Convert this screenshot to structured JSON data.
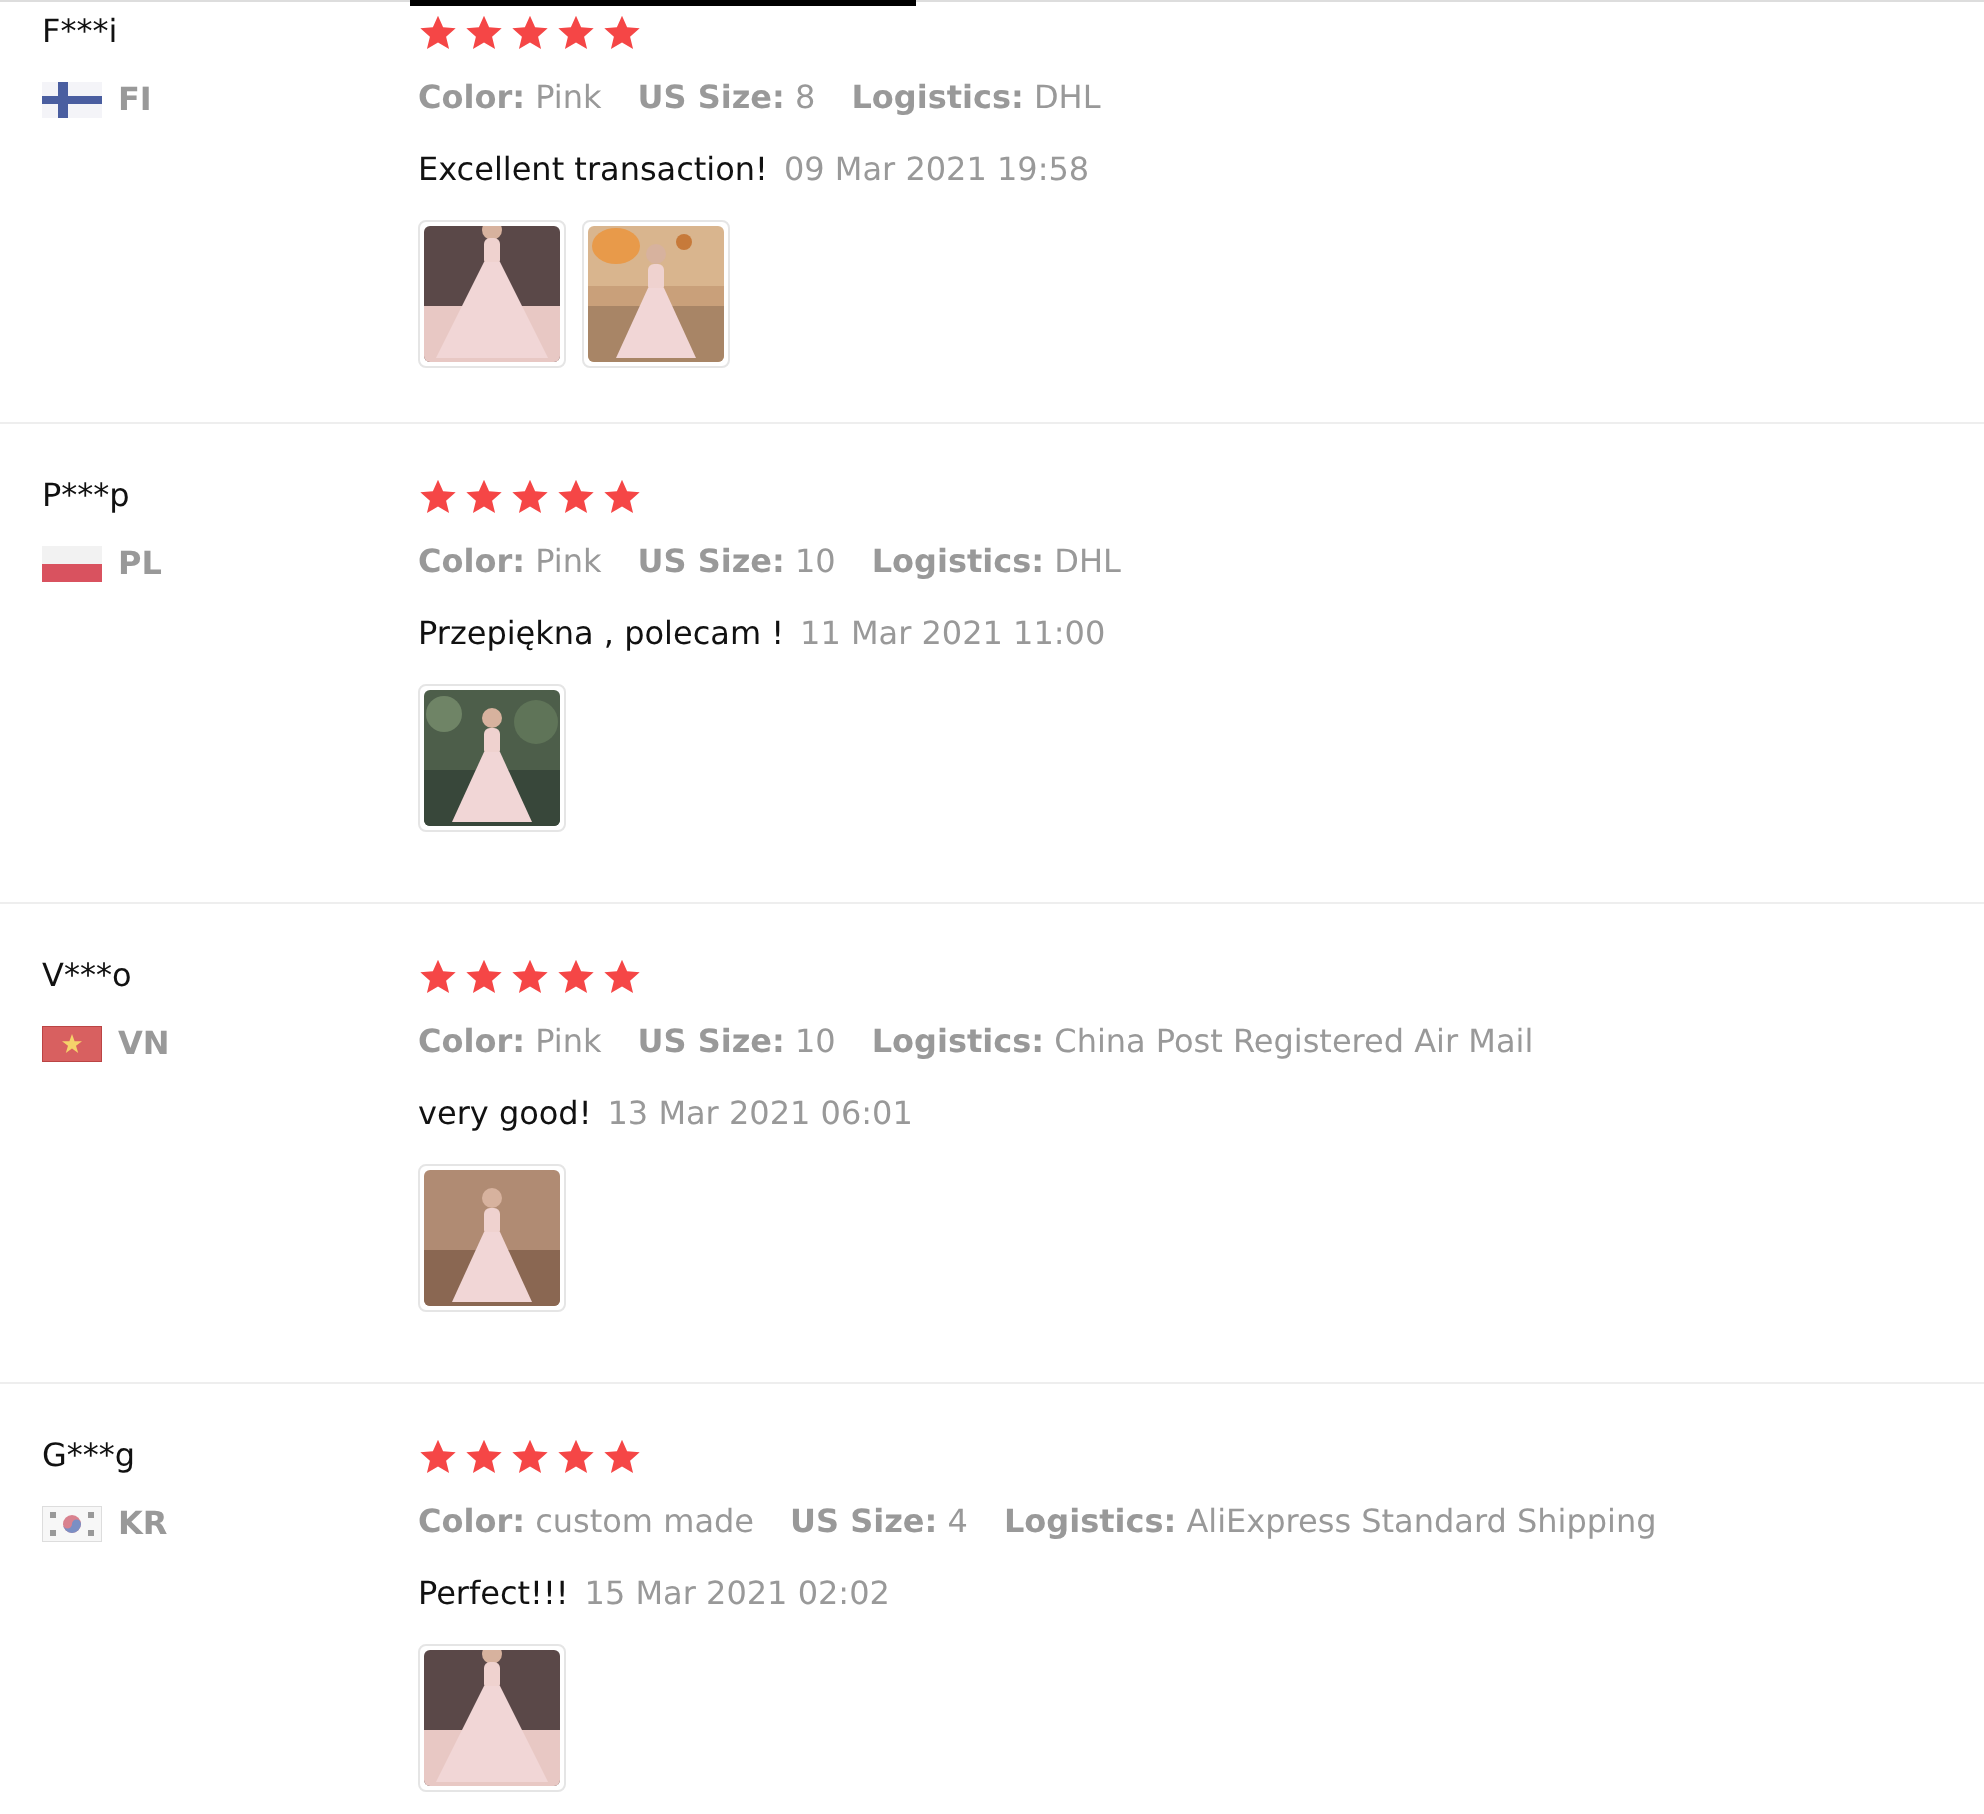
{
  "reviews": [
    {
      "name": "F***i",
      "kind": "finland",
      "country": "FI",
      "stars": 5,
      "attributes": [
        {
          "label": "Color:",
          "value": "Pink"
        },
        {
          "label": "US Size:",
          "value": "8"
        },
        {
          "label": "Logistics:",
          "value": "DHL"
        }
      ],
      "comment": "Excellent transaction!",
      "date": "09 Mar 2021 19:58",
      "images": [
        {
          "kind": "picture"
        },
        {
          "kind": "picture"
        }
      ]
    },
    {
      "name": "P***p",
      "kind": "poland",
      "country": "PL",
      "stars": 5,
      "attributes": [
        {
          "label": "Color:",
          "value": "Pink"
        },
        {
          "label": "US Size:",
          "value": "10"
        },
        {
          "label": "Logistics:",
          "value": "DHL"
        }
      ],
      "comment": "Przepiękna , polecam !",
      "date": "11 Mar 2021 11:00",
      "images": [
        {
          "kind": "picture"
        }
      ]
    },
    {
      "name": "V***o",
      "kind": "vietnam",
      "country": "VN",
      "stars": 5,
      "attributes": [
        {
          "label": "Color:",
          "value": "Pink"
        },
        {
          "label": "US Size:",
          "value": "10"
        },
        {
          "label": "Logistics:",
          "value": "China Post Registered Air Mail"
        }
      ],
      "comment": "very good!",
      "date": "13 Mar 2021 06:01",
      "images": [
        {
          "kind": "picture"
        }
      ]
    },
    {
      "name": "G***g",
      "kind": "korea",
      "country": "KR",
      "stars": 5,
      "attributes": [
        {
          "label": "Color:",
          "value": "custom made"
        },
        {
          "label": "US Size:",
          "value": "4"
        },
        {
          "label": "Logistics:",
          "value": "AliExpress Standard Shipping"
        }
      ],
      "comment": "Perfect!!!",
      "date": "15 Mar 2021 02:02",
      "images": [
        {
          "kind": "picture"
        }
      ]
    }
  ]
}
